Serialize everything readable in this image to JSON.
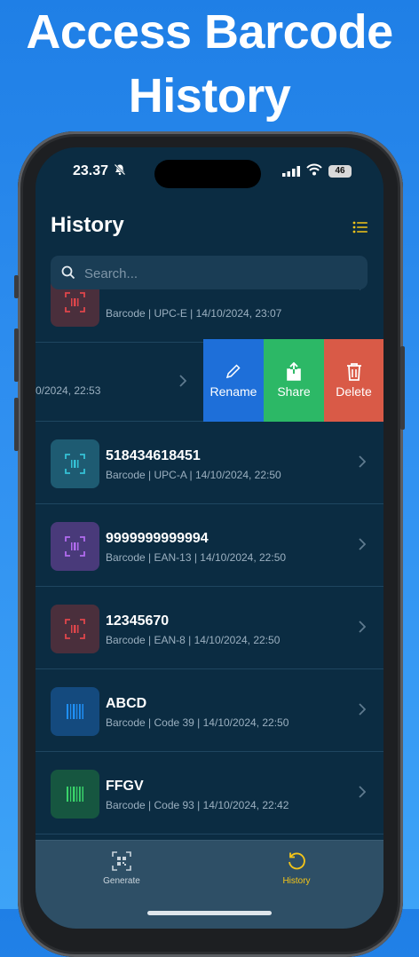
{
  "headline": {
    "line1": "Access Barcode",
    "line2": "History"
  },
  "status": {
    "time": "23.37",
    "battery": "46"
  },
  "header": {
    "title": "History"
  },
  "search": {
    "placeholder": "Search..."
  },
  "items": [
    {
      "name": "",
      "meta": "Barcode | UPC-E | 14/10/2024, 23:07",
      "color": "#e0464b",
      "bg": "#4a2f3c"
    },
    {
      "name": "",
      "meta": "0/2024, 22:53"
    },
    {
      "name": "518434618451",
      "meta": "Barcode | UPC-A | 14/10/2024, 22:50",
      "color": "#35c2d6",
      "bg": "#1e5b72"
    },
    {
      "name": "9999999999994",
      "meta": "Barcode | EAN-13 | 14/10/2024, 22:50",
      "color": "#b26cf0",
      "bg": "#493a7a"
    },
    {
      "name": "12345670",
      "meta": "Barcode | EAN-8 | 14/10/2024, 22:50",
      "color": "#e0464b",
      "bg": "#4a2f3c"
    },
    {
      "name": "ABCD",
      "meta": "Barcode | Code 39 | 14/10/2024, 22:50",
      "color": "#1f8ff5",
      "bg": "#144a7e"
    },
    {
      "name": "FFGV",
      "meta": "Barcode | Code 93 | 14/10/2024, 22:42",
      "color": "#39d36a",
      "bg": "#165640"
    }
  ],
  "swipe_actions": {
    "rename": "Rename",
    "share": "Share",
    "delete": "Delete",
    "rename_color": "#1e6fd9",
    "share_color": "#2cb866",
    "delete_color": "#d95a47"
  },
  "tabs": [
    {
      "label": "Generate",
      "icon": "qr-scan-icon",
      "active": false
    },
    {
      "label": "History",
      "icon": "history-icon",
      "active": true
    }
  ],
  "colors": {
    "accent": "#f5c518",
    "background": "#0b2c42"
  }
}
